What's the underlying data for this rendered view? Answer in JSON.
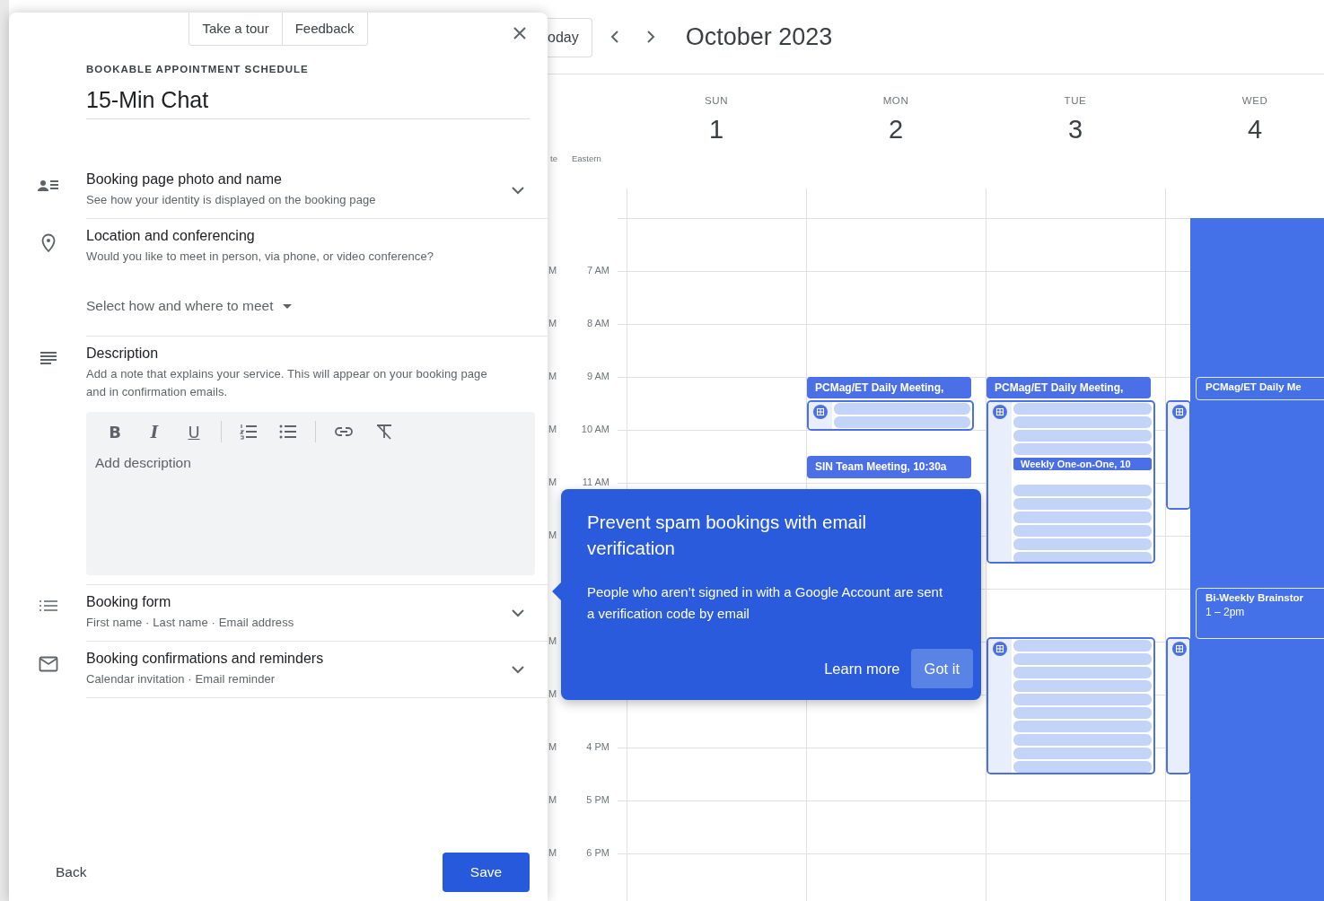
{
  "panel": {
    "tour_buttons": [
      "Take a tour",
      "Feedback"
    ],
    "eyebrow": "BOOKABLE APPOINTMENT SCHEDULE",
    "title_value": "15-Min Chat",
    "sections": [
      {
        "kind": "collapsible",
        "title": "Booking page photo and name",
        "subtitle": "See how your identity is displayed on the booking page",
        "expanded": false
      },
      {
        "kind": "select",
        "title": "Location and conferencing",
        "subtitle": "Would you like to meet in person, via phone, or video conference?",
        "select_label": "Select how and where to meet"
      },
      {
        "kind": "editor",
        "title": "Description",
        "subtitle": "Add a note that explains your service. This will appear on your booking page and in confirmation emails.",
        "format_buttons": [
          "B",
          "I",
          "U"
        ],
        "placeholder": "Add description"
      },
      {
        "kind": "collapsible",
        "title": "Booking form",
        "subtitle": "First name · Last name · Email address",
        "expanded": false
      },
      {
        "kind": "collapsible",
        "title": "Booking confirmations and reminders",
        "subtitle": "Calendar invitation · Email reminder",
        "expanded": false
      }
    ],
    "footer": {
      "back": "Back",
      "save": "Save"
    }
  },
  "calendar": {
    "today_button": "oday",
    "month": "October 2023",
    "timezone_labels": [
      "te",
      "Eastern"
    ],
    "hour_labels": [
      "7 AM",
      "8 AM",
      "9 AM",
      "10 AM",
      "11 AM",
      "4 PM",
      "5 PM",
      "6 PM"
    ],
    "secondary_hour_labels": [
      "M",
      "M",
      "M",
      "M",
      "M",
      "M",
      "M",
      "M",
      "M",
      "M",
      "M"
    ],
    "days": [
      {
        "weekday": "SUN",
        "date": "1",
        "highlighted": false
      },
      {
        "weekday": "MON",
        "date": "2",
        "highlighted": false,
        "events": [
          {
            "kind": "chip",
            "title": "PCMag/ET Daily Meeting,"
          },
          {
            "kind": "group",
            "rows": [
              {
                "kind": "placeholder"
              },
              {
                "kind": "placeholder"
              }
            ]
          },
          {
            "kind": "chip",
            "title": "SIN Team Meeting, 10:30a"
          }
        ]
      },
      {
        "weekday": "TUE",
        "date": "3",
        "highlighted": false,
        "events": [
          {
            "kind": "chip",
            "title": "PCMag/ET Daily Meeting,"
          },
          {
            "kind": "group",
            "rows": [
              {
                "kind": "placeholder"
              },
              {
                "kind": "placeholder"
              },
              {
                "kind": "placeholder"
              },
              {
                "kind": "placeholder"
              },
              {
                "kind": "chip",
                "title": "Weekly One-on-One, 10"
              },
              {
                "kind": "placeholder"
              },
              {
                "kind": "placeholder"
              },
              {
                "kind": "placeholder"
              },
              {
                "kind": "placeholder"
              },
              {
                "kind": "placeholder"
              },
              {
                "kind": "placeholder"
              }
            ]
          },
          {
            "kind": "group",
            "rows": [
              {
                "kind": "placeholder"
              },
              {
                "kind": "placeholder"
              },
              {
                "kind": "placeholder"
              },
              {
                "kind": "placeholder"
              },
              {
                "kind": "placeholder"
              },
              {
                "kind": "placeholder"
              },
              {
                "kind": "placeholder"
              },
              {
                "kind": "placeholder"
              },
              {
                "kind": "placeholder"
              },
              {
                "kind": "placeholder"
              }
            ]
          }
        ]
      },
      {
        "weekday": "WED",
        "date": "4",
        "highlighted": true,
        "events": [
          {
            "kind": "group"
          },
          {
            "kind": "group"
          },
          {
            "kind": "outline",
            "title": "PCMag/ET Daily Me"
          },
          {
            "kind": "outline",
            "title": "Bi-Weekly Brainstor",
            "time": "1 – 2pm"
          }
        ]
      }
    ]
  },
  "tip": {
    "title": "Prevent spam bookings with email verification",
    "body": "People who aren’t signed in with a Google Account are sent a verification code by email",
    "actions": [
      {
        "kind": "text",
        "label": "Learn more"
      },
      {
        "kind": "tonal",
        "label": "Got it"
      }
    ]
  }
}
